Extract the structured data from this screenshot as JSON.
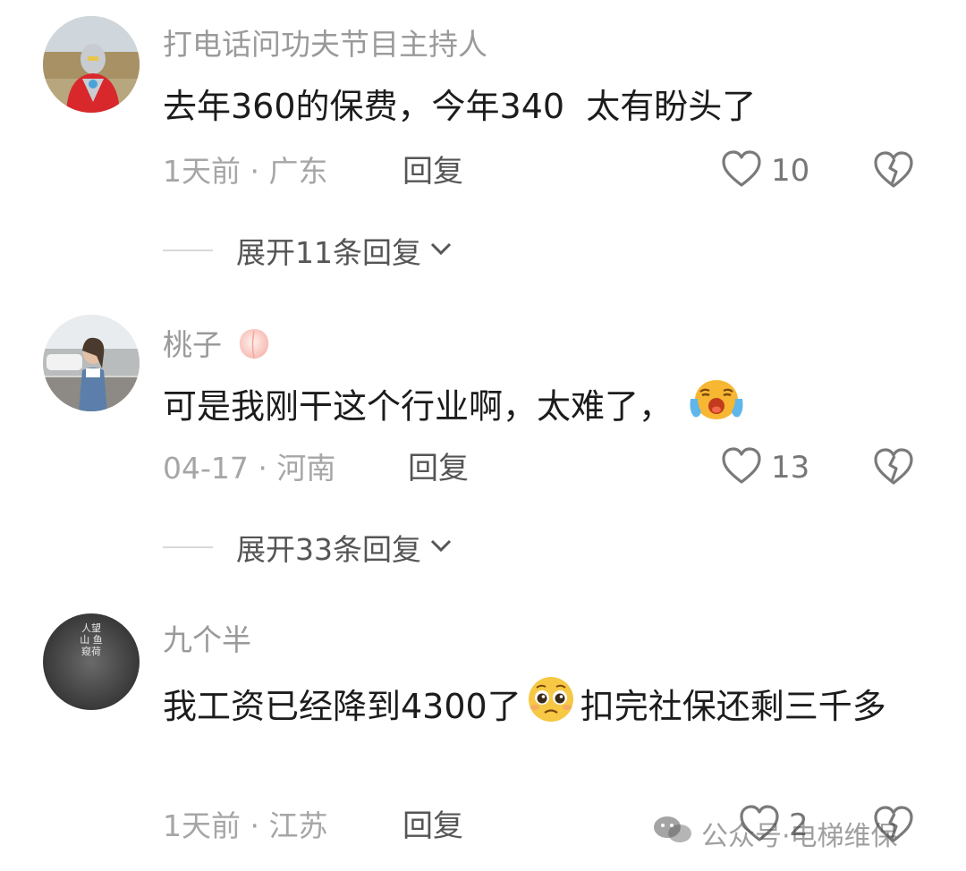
{
  "comments": [
    {
      "username": "打电话问功夫节目主持人",
      "content": "去年360的保费，今年340  太有盼头了",
      "time": "1天前",
      "location": "广东",
      "reply_label": "回复",
      "likes": "10",
      "expand_label": "展开11条回复"
    },
    {
      "username": "桃子",
      "content": "可是我刚干这个行业啊，太难了，",
      "time": "04-17",
      "location": "河南",
      "reply_label": "回复",
      "likes": "13",
      "expand_label": "展开33条回复"
    },
    {
      "username": "九个半",
      "content_part1": "我工资已经降到4300了",
      "content_part2": "扣完社保还剩三千多",
      "avatar_text": "人望山 鱼窥荷",
      "time": "1天前",
      "location": "江苏",
      "reply_label": "回复",
      "likes": "2"
    }
  ],
  "watermark": "公众号·电梯维保",
  "icons": {
    "like": "heart-outline-icon",
    "dislike": "broken-heart-icon",
    "expand": "chevron-down-icon",
    "emoji_peach": "peach-emoji",
    "emoji_crying": "crying-face-emoji",
    "emoji_pleading": "pleading-face-emoji"
  },
  "colors": {
    "text_primary": "#1c1c1c",
    "text_secondary": "#9a9a9a",
    "icon_gray": "#7a7a7a"
  }
}
